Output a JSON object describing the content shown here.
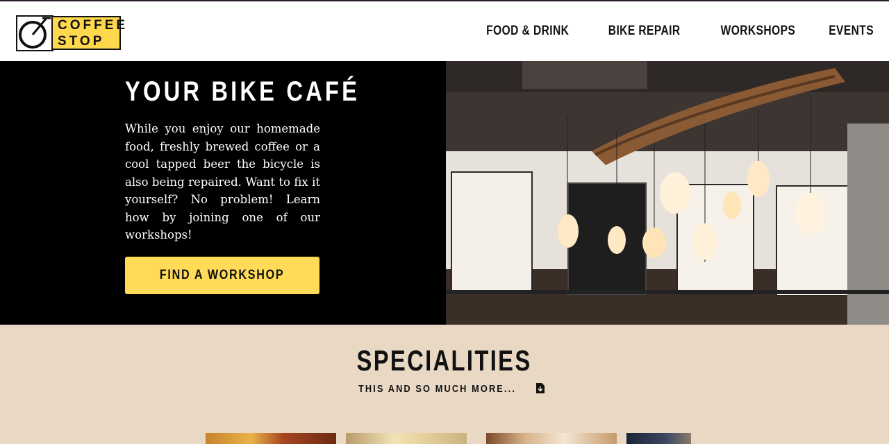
{
  "brand": {
    "logo_line1": "COFFEE",
    "logo_line2": "STOP",
    "accent_color": "#ffdb58"
  },
  "nav": {
    "items": [
      {
        "label": "FOOD & DRINK"
      },
      {
        "label": "BIKE REPAIR"
      },
      {
        "label": "WORKSHOPS"
      },
      {
        "label": "EVENTS"
      }
    ]
  },
  "hero": {
    "title": "YOUR BIKE CAFÉ",
    "text": "While you enjoy our homemade food, freshly brewed coffee or a cool tapped beer the bicycle is also being repaired. Want to fix it yourself? No problem! Learn how by joining one of our workshops!",
    "cta_label": "FIND A WORKSHOP",
    "image_icon": "cafe-interior-photo"
  },
  "specialities": {
    "title": "SPECIALITIES",
    "subtitle": "THIS AND SO MUCH MORE...",
    "subtitle_icon": "download-icon",
    "thumbnails": [
      "food-photo",
      "food-photo",
      "food-photo",
      "food-photo"
    ]
  }
}
